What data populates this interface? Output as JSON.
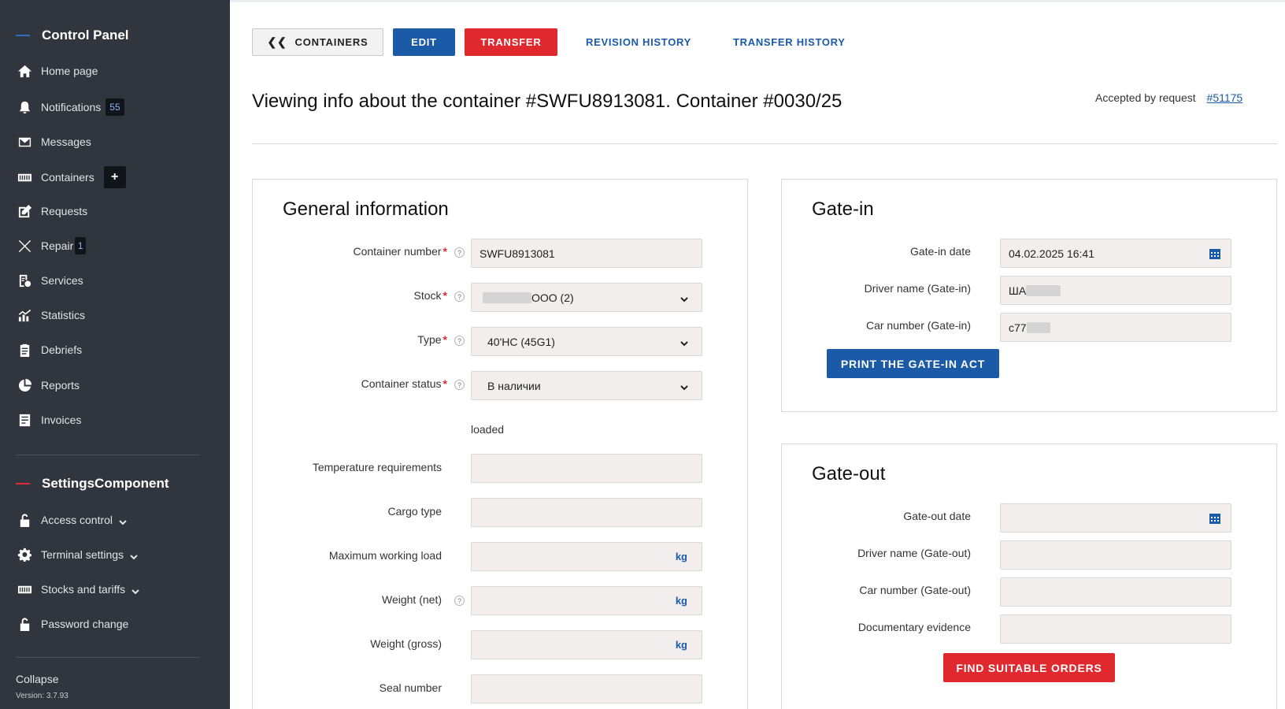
{
  "sidebar": {
    "title": "Control Panel",
    "items": [
      {
        "label": "Home page",
        "icon": "home-icon"
      },
      {
        "label": "Notifications",
        "icon": "bell-icon",
        "badge": "55"
      },
      {
        "label": "Messages",
        "icon": "envelope-icon"
      },
      {
        "label": "Containers",
        "icon": "containers-icon",
        "badge": "+"
      },
      {
        "label": "Requests",
        "icon": "edit-icon"
      },
      {
        "label": "Repair",
        "icon": "tools-icon",
        "badge": "1"
      },
      {
        "label": "Services",
        "icon": "services-icon"
      },
      {
        "label": "Statistics",
        "icon": "chart-icon"
      },
      {
        "label": "Debriefs",
        "icon": "clipboard-icon"
      },
      {
        "label": "Reports",
        "icon": "pie-chart-icon"
      },
      {
        "label": "Invoices",
        "icon": "invoice-icon"
      }
    ],
    "settings_title": "SettingsComponent",
    "settings_items": [
      {
        "label": "Access control",
        "icon": "lock-icon"
      },
      {
        "label": "Terminal settings",
        "icon": "gear-icon"
      },
      {
        "label": "Stocks and tariffs",
        "icon": "containers-icon"
      },
      {
        "label": "Password change",
        "icon": "lock-icon"
      }
    ],
    "collapse": "Collapse",
    "version": "Version: 3.7.93"
  },
  "toolbar": {
    "back_label": "CONTAINERS",
    "edit_label": "EDIT",
    "transfer_label": "TRANSFER",
    "revision_history": "REVISION HISTORY",
    "transfer_history": "TRANSFER HISTORY"
  },
  "header": {
    "title": "Viewing info about the container #SWFU8913081. Container #0030/25",
    "accepted_label": "Accepted by request",
    "accepted_link": "#51175"
  },
  "general": {
    "title": "General information",
    "container_number_label": "Container number",
    "container_number_value": "SWFU8913081",
    "stock_label": "Stock",
    "stock_value": "ООО (2)",
    "type_label": "Type",
    "type_value": "40'HC (45G1)",
    "status_label": "Container status",
    "status_value": "В наличии",
    "loaded_text": "loaded",
    "temperature_label": "Temperature requirements",
    "cargo_type_label": "Cargo type",
    "max_load_label": "Maximum working load",
    "weight_net_label": "Weight (net)",
    "weight_gross_label": "Weight (gross)",
    "seal_label": "Seal number",
    "unit": "kg"
  },
  "gate_in": {
    "title": "Gate-in",
    "date_label": "Gate-in date",
    "date_value": "04.02.2025 16:41",
    "driver_label": "Driver name (Gate-in)",
    "driver_value": "ША",
    "car_label": "Car number (Gate-in)",
    "car_value": "с77",
    "print_button": "PRINT THE GATE-IN ACT"
  },
  "gate_out": {
    "title": "Gate-out",
    "date_label": "Gate-out date",
    "driver_label": "Driver name (Gate-out)",
    "car_label": "Car number (Gate-out)",
    "docs_label": "Documentary evidence",
    "find_button": "FIND SUITABLE ORDERS"
  },
  "colors": {
    "sidebar_bg": "#31353d",
    "primary": "#1b5aa6",
    "danger": "#e0292e",
    "field_bg": "#f2eeee"
  }
}
